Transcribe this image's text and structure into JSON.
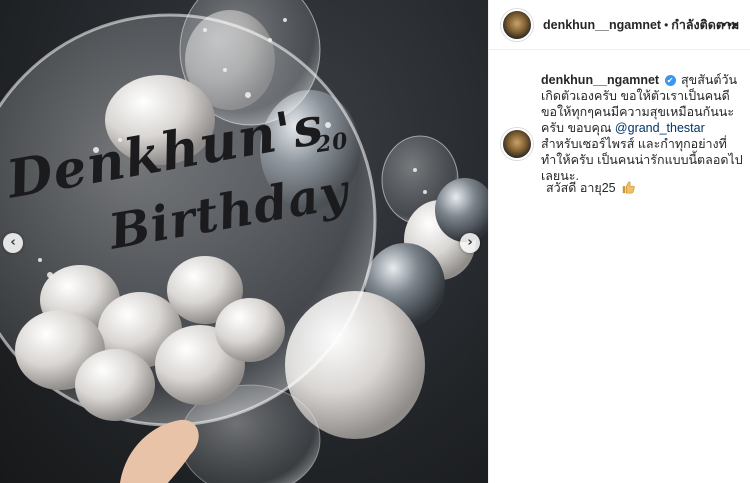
{
  "photo": {
    "balloon_line1": "Denkhun's",
    "balloon_line2": "Birthday",
    "balloon_number": "20",
    "prev_icon": "‹",
    "next_icon": "›"
  },
  "header": {
    "username": "denkhun__ngamnet",
    "dot": "•",
    "follow_status": "กำลังติดตาม",
    "more_icon": "•••"
  },
  "caption": {
    "username": "denkhun__ngamnet",
    "verified_icon": "✔",
    "text_1": "สุขสันต์วันเกิดตัวเองครับ ขอให้ตัวเราเป็นคนดี ขอให้ทุกๆคนมีความสุขเหมือนกันนะครับ ขอบคุณ",
    "mention": "@grand_thestar",
    "text_2": "สำหรับเซอร์ไพรส์ และกำทุกอย่างที่ทำให้ครับ เป็นคนน่ารักแบบนี้ตลอดไปเลยนะ."
  },
  "comment": {
    "text": "สวัสดี อายุ25"
  }
}
